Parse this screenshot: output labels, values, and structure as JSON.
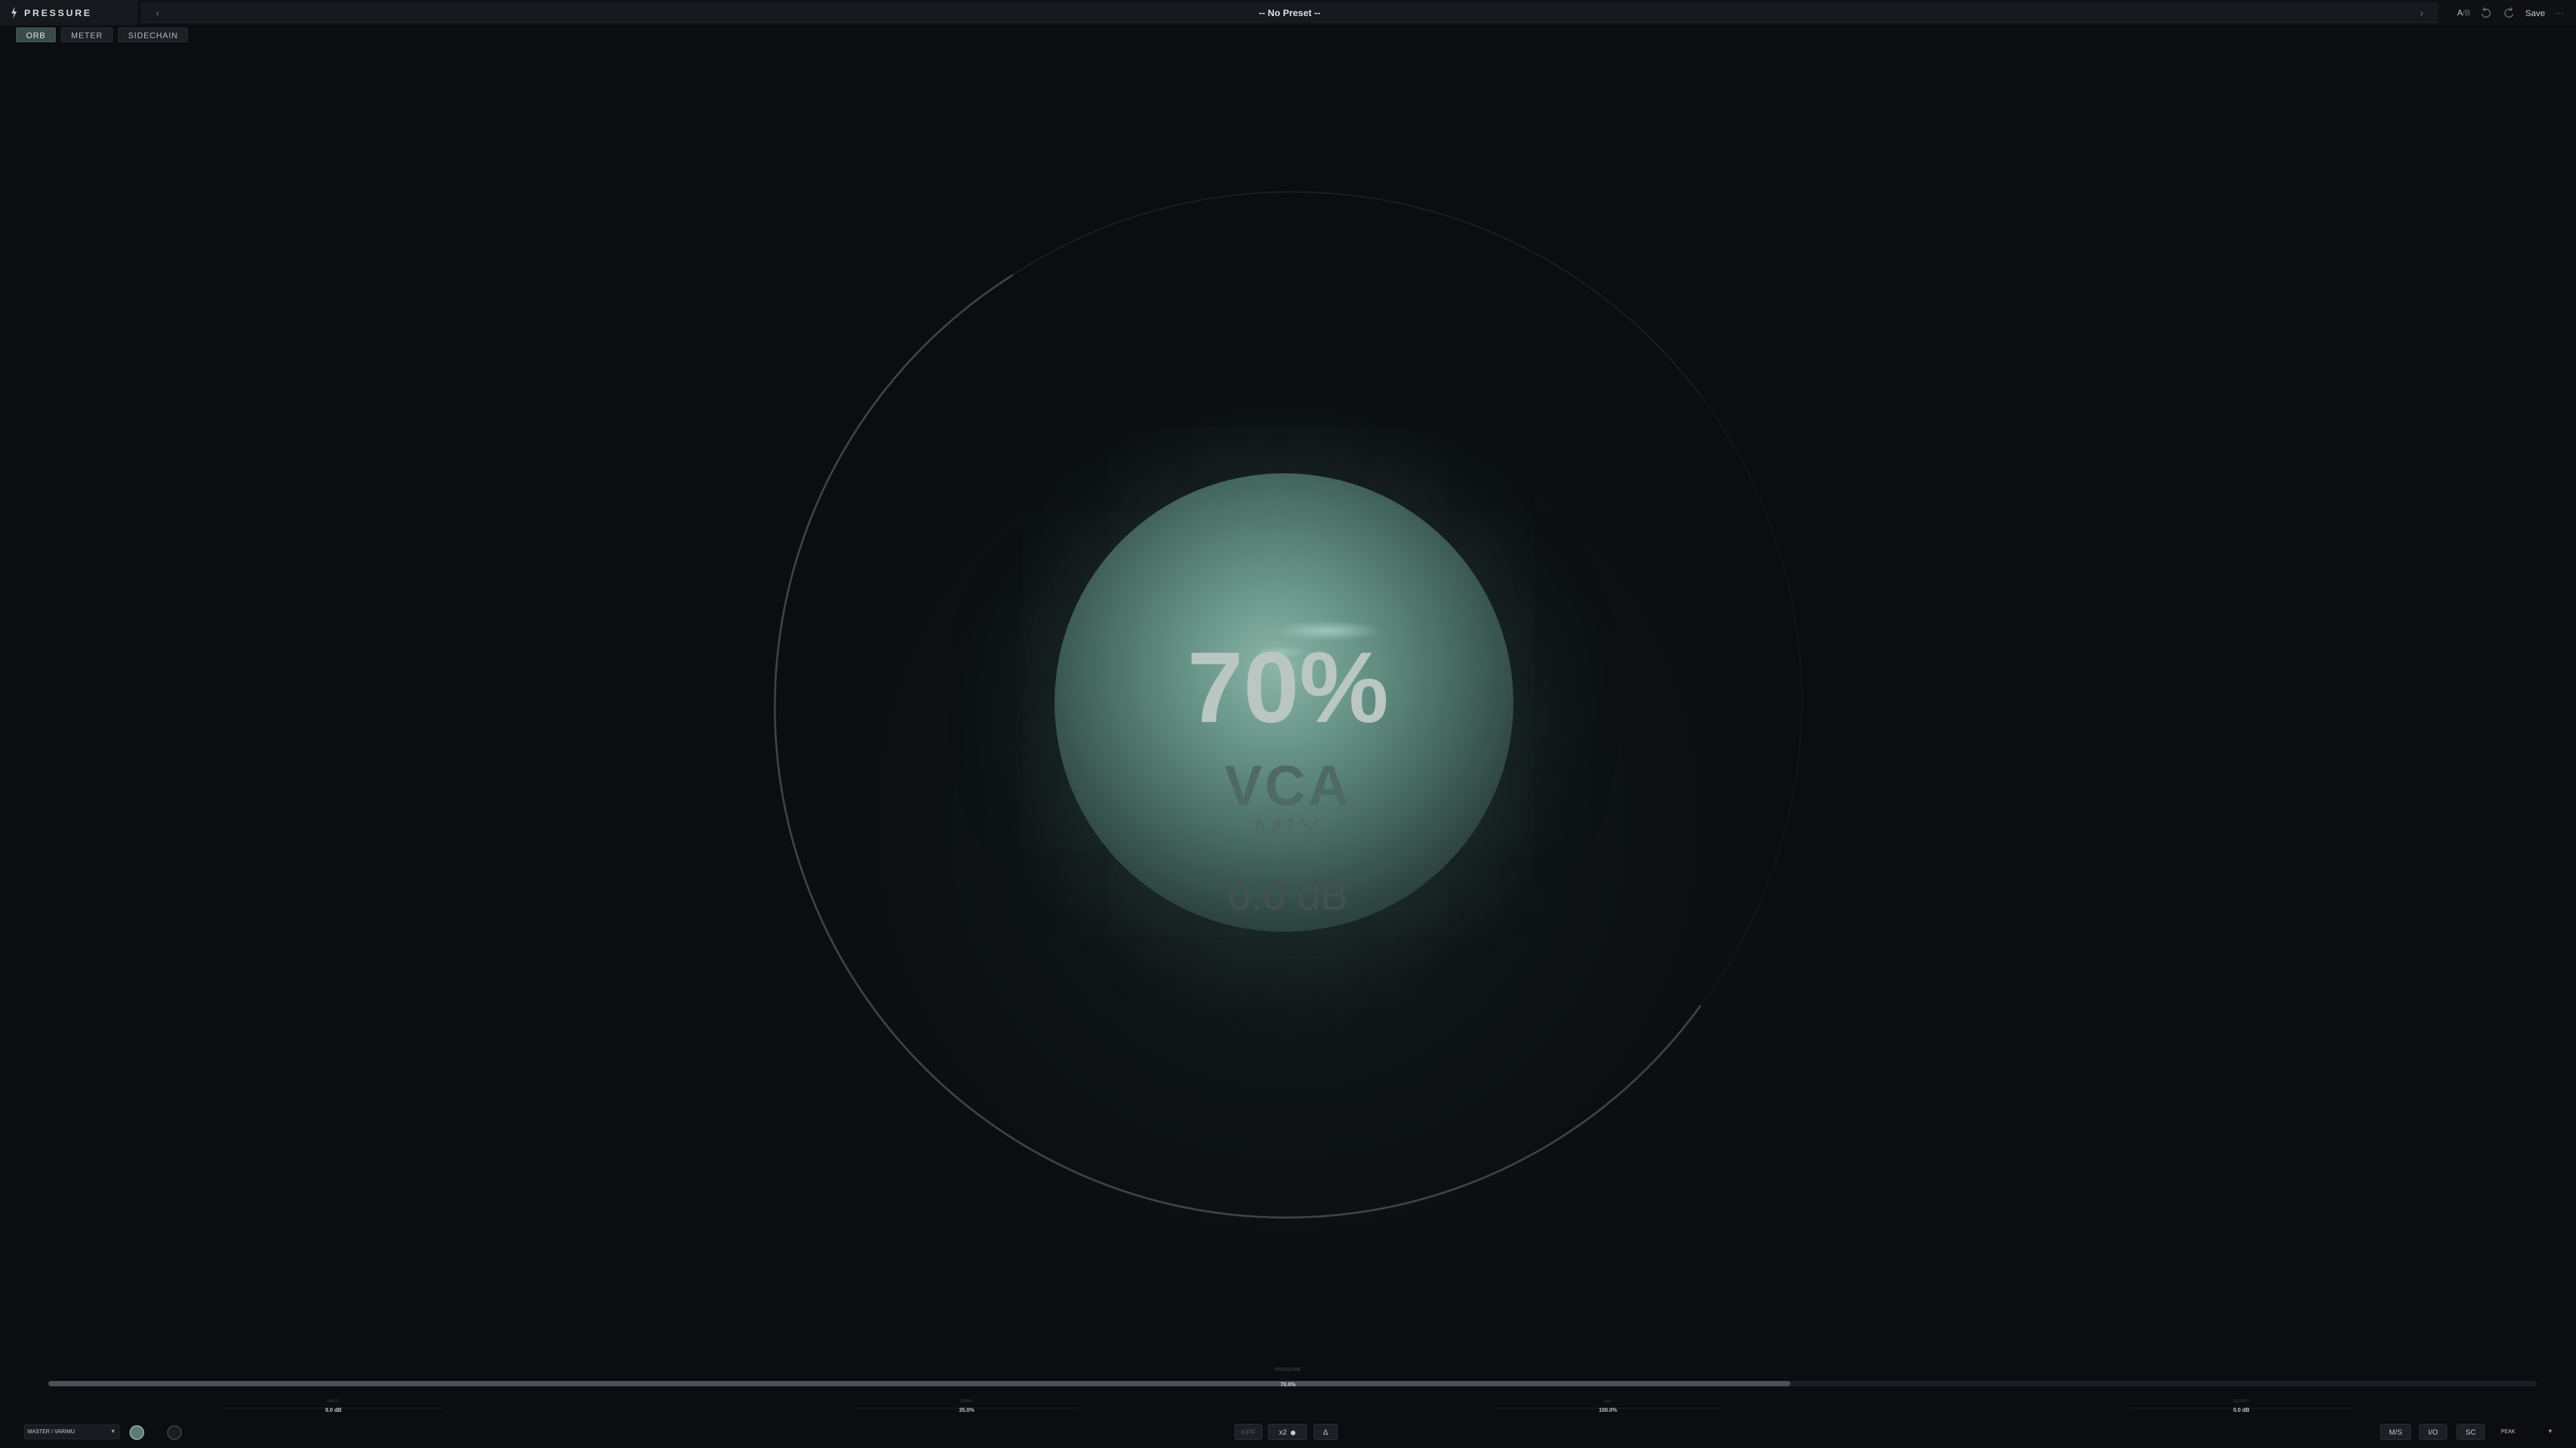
{
  "app": {
    "name": "PRESSURE"
  },
  "preset": {
    "name": "-- No Preset --",
    "prev": "‹",
    "next": "›"
  },
  "toolbar": {
    "ab_a": "A",
    "ab_sep": "/",
    "ab_b": "B",
    "save": "Save",
    "more": "···"
  },
  "tabs": [
    {
      "label": "ORB",
      "active": true
    },
    {
      "label": "METER",
      "active": false
    },
    {
      "label": "SIDECHAIN",
      "active": false
    }
  ],
  "orb": {
    "value": "70%",
    "mode": "VCA",
    "label": "MIX",
    "gain": "0.0 dB"
  },
  "main_slider": {
    "label": "PRESSURE",
    "value": "70.0%",
    "fraction": 0.7
  },
  "params": [
    {
      "name": "INPUT",
      "value": "0.0 dB"
    },
    {
      "name": "DRIVE",
      "value": "35.0%"
    },
    {
      "name": "MIX",
      "value": "100.0%"
    },
    {
      "name": "OUTPUT",
      "value": "0.0 dB"
    }
  ],
  "bottom": {
    "mode_select": "MASTER / VARIMU",
    "hpf": "HPF",
    "x2": "x2",
    "delta": "Δ",
    "ms": "M/S",
    "io": "I/O",
    "sc": "SC",
    "peak": "PEAK"
  },
  "colors": {
    "accent": "#6a978a",
    "background": "#0b0d10"
  }
}
